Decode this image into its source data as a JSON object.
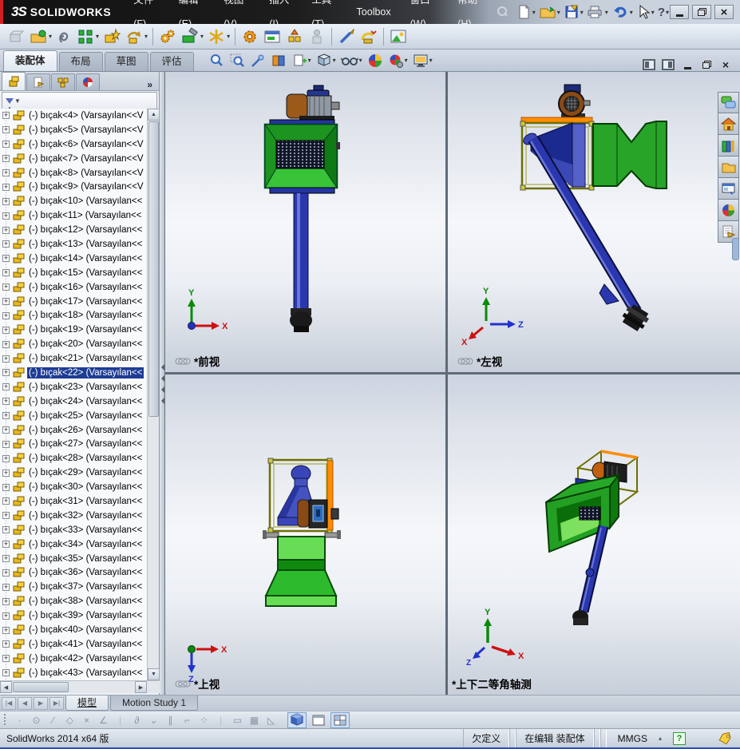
{
  "titlebar": {
    "brand_mark": "3S",
    "brand": "SOLIDWORKS",
    "menus": [
      {
        "label": "文件(F)"
      },
      {
        "label": "编辑(E)"
      },
      {
        "label": "视图(V)"
      },
      {
        "label": "插入(I)"
      },
      {
        "label": "工具(T)"
      },
      {
        "label": "Toolbox"
      },
      {
        "label": "窗口(W)"
      },
      {
        "label": "帮助(H)"
      }
    ]
  },
  "command_tabs": {
    "tabs": [
      {
        "label": "装配体",
        "active": true
      },
      {
        "label": "布局"
      },
      {
        "label": "草图"
      },
      {
        "label": "评估"
      }
    ]
  },
  "feature_tree": {
    "expand_more": "»",
    "items": [
      {
        "label": "(-) bıçak<4> (Varsayılan<<V"
      },
      {
        "label": "(-) bıçak<5> (Varsayılan<<V"
      },
      {
        "label": "(-) bıçak<6> (Varsayılan<<V"
      },
      {
        "label": "(-) bıçak<7> (Varsayılan<<V"
      },
      {
        "label": "(-) bıçak<8> (Varsayılan<<V"
      },
      {
        "label": "(-) bıçak<9> (Varsayılan<<V"
      },
      {
        "label": "(-) bıçak<10> (Varsayılan<<"
      },
      {
        "label": "(-) bıçak<11> (Varsayılan<<"
      },
      {
        "label": "(-) bıçak<12> (Varsayılan<<"
      },
      {
        "label": "(-) bıçak<13> (Varsayılan<<"
      },
      {
        "label": "(-) bıçak<14> (Varsayılan<<"
      },
      {
        "label": "(-) bıçak<15> (Varsayılan<<"
      },
      {
        "label": "(-) bıçak<16> (Varsayılan<<"
      },
      {
        "label": "(-) bıçak<17> (Varsayılan<<"
      },
      {
        "label": "(-) bıçak<18> (Varsayılan<<"
      },
      {
        "label": "(-) bıçak<19> (Varsayılan<<"
      },
      {
        "label": "(-) bıçak<20> (Varsayılan<<"
      },
      {
        "label": "(-) bıçak<21> (Varsayılan<<"
      },
      {
        "label": "(-) bıçak<22> (Varsayılan<<",
        "selected": true
      },
      {
        "label": "(-) bıçak<23> (Varsayılan<<"
      },
      {
        "label": "(-) bıçak<24> (Varsayılan<<"
      },
      {
        "label": "(-) bıçak<25> (Varsayılan<<"
      },
      {
        "label": "(-) bıçak<26> (Varsayılan<<"
      },
      {
        "label": "(-) bıçak<27> (Varsayılan<<"
      },
      {
        "label": "(-) bıçak<28> (Varsayılan<<"
      },
      {
        "label": "(-) bıçak<29> (Varsayılan<<"
      },
      {
        "label": "(-) bıçak<30> (Varsayılan<<"
      },
      {
        "label": "(-) bıçak<31> (Varsayılan<<"
      },
      {
        "label": "(-) bıçak<32> (Varsayılan<<"
      },
      {
        "label": "(-) bıçak<33> (Varsayılan<<"
      },
      {
        "label": "(-) bıçak<34> (Varsayılan<<"
      },
      {
        "label": "(-) bıçak<35> (Varsayılan<<"
      },
      {
        "label": "(-) bıçak<36> (Varsayılan<<"
      },
      {
        "label": "(-) bıçak<37> (Varsayılan<<"
      },
      {
        "label": "(-) bıçak<38> (Varsayılan<<"
      },
      {
        "label": "(-) bıçak<39> (Varsayılan<<"
      },
      {
        "label": "(-) bıçak<40> (Varsayılan<<"
      },
      {
        "label": "(-) bıçak<41> (Varsayılan<<"
      },
      {
        "label": "(-) bıçak<42> (Varsayılan<<"
      },
      {
        "label": "(-) bıçak<43> (Varsayılan<<"
      }
    ]
  },
  "viewports": {
    "front": {
      "label": "*前视"
    },
    "left": {
      "label": "*左视"
    },
    "top": {
      "label": "*上视"
    },
    "iso": {
      "label": "*上下二等角轴测"
    }
  },
  "axes": {
    "x": "X",
    "y": "Y",
    "z": "Z"
  },
  "bottom_tabs": {
    "model": "模型",
    "motion_study": "Motion Study 1"
  },
  "status_bar": {
    "app_version": "SolidWorks 2014 x64 版",
    "definition_state": "欠定义",
    "edit_state": "在编辑 装配体",
    "units": "MMGS"
  }
}
